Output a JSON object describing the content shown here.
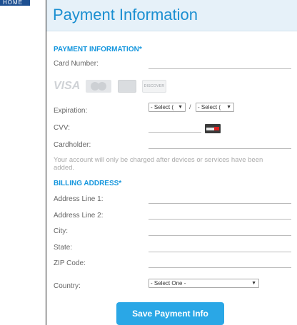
{
  "corner_tab": "HOME",
  "header": {
    "title": "Payment Information"
  },
  "payment": {
    "section_title": "PAYMENT INFORMATION*",
    "card_number_label": "Card Number:",
    "card_brands": [
      "VISA",
      "MasterCard",
      "American Express",
      "DISCOVER"
    ],
    "expiration_label": "Expiration:",
    "exp_month": "- Select (",
    "exp_year": "- Select (",
    "exp_separator": "/",
    "cvv_label": "CVV:",
    "cardholder_label": "Cardholder:",
    "note": "Your account will only be charged after devices or services have been added."
  },
  "billing": {
    "section_title": "BILLING ADDRESS*",
    "address1_label": "Address Line 1:",
    "address2_label": "Address Line 2:",
    "city_label": "City:",
    "state_label": "State:",
    "zip_label": "ZIP Code:",
    "country_label": "Country:",
    "country_value": "- Select One -"
  },
  "save_label": "Save Payment Info",
  "colors": {
    "accent": "#1596dd",
    "button": "#2aa7e6",
    "header_bg": "#e6f1f9"
  }
}
